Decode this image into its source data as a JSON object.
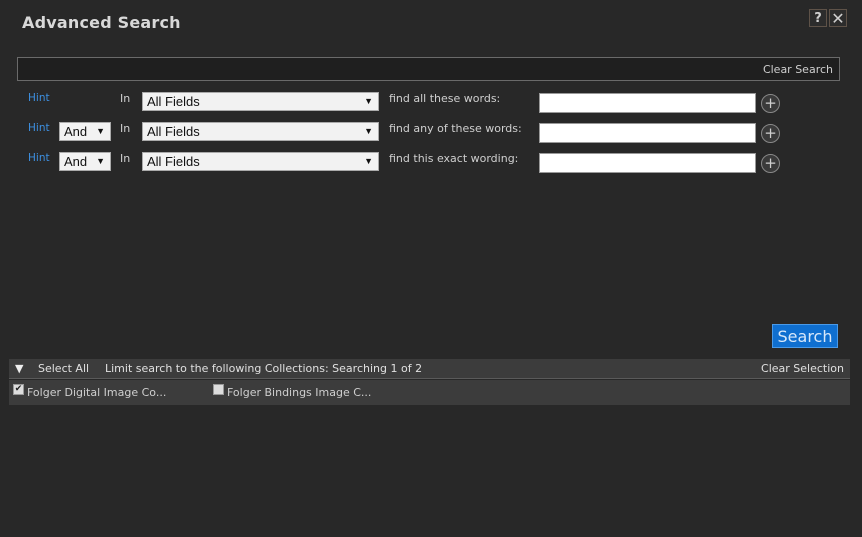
{
  "dialog": {
    "title": "Advanced Search",
    "help_label": "?",
    "close_label": "✕"
  },
  "search_bar": {
    "value": "",
    "clear_label": "Clear Search"
  },
  "rows": [
    {
      "hint": "Hint",
      "boolean": null,
      "in_label": "In",
      "field": "All Fields",
      "find_label": "find all these words:",
      "value": ""
    },
    {
      "hint": "Hint",
      "boolean": "And",
      "in_label": "In",
      "field": "All Fields",
      "find_label": "find any of these words:",
      "value": ""
    },
    {
      "hint": "Hint",
      "boolean": "And",
      "in_label": "In",
      "field": "All Fields",
      "find_label": "find this exact wording:",
      "value": ""
    }
  ],
  "icons": {
    "dropdown_arrow": "▼",
    "add": "+",
    "collapse": "▼",
    "check": "✔"
  },
  "search_button": "Search",
  "collections": {
    "select_all": "Select All",
    "limit_text": "Limit search to the following Collections: Searching 1 of 2",
    "clear_selection": "Clear Selection",
    "items": [
      {
        "label": "Folger Digital Image Co...",
        "checked": true
      },
      {
        "label": "Folger Bindings Image C...",
        "checked": false
      }
    ]
  },
  "colors": {
    "accent": "#0f6fd0",
    "link": "#3d8fe0",
    "background": "#282828"
  }
}
